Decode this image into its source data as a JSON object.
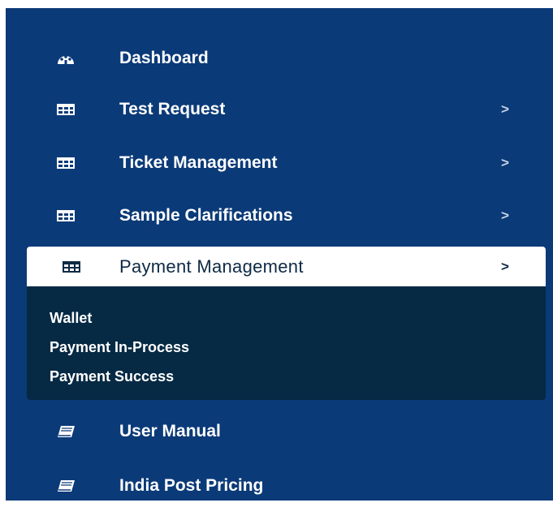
{
  "menu": {
    "items": [
      {
        "label": "Dashboard",
        "icon": "palette-icon",
        "has_chevron": false
      },
      {
        "label": "Test Request",
        "icon": "table-icon",
        "chevron": ">"
      },
      {
        "label": "Ticket Management",
        "icon": "table-icon",
        "chevron": ">"
      },
      {
        "label": "Sample Clarifications",
        "icon": "table-icon",
        "chevron": ">"
      },
      {
        "label": "Payment Management",
        "icon": "table-icon",
        "chevron": ">",
        "active": true
      },
      {
        "label": "User Manual",
        "icon": "book-icon",
        "has_chevron": false
      },
      {
        "label": "India Post Pricing",
        "icon": "book-icon",
        "has_chevron": false
      }
    ],
    "submenu": [
      "Wallet",
      "Payment In-Process",
      "Payment Success"
    ]
  },
  "colors": {
    "sidebar_bg": "#0b3a78",
    "submenu_bg": "#062a44",
    "active_bg": "#ffffff",
    "text": "#ffffff"
  }
}
